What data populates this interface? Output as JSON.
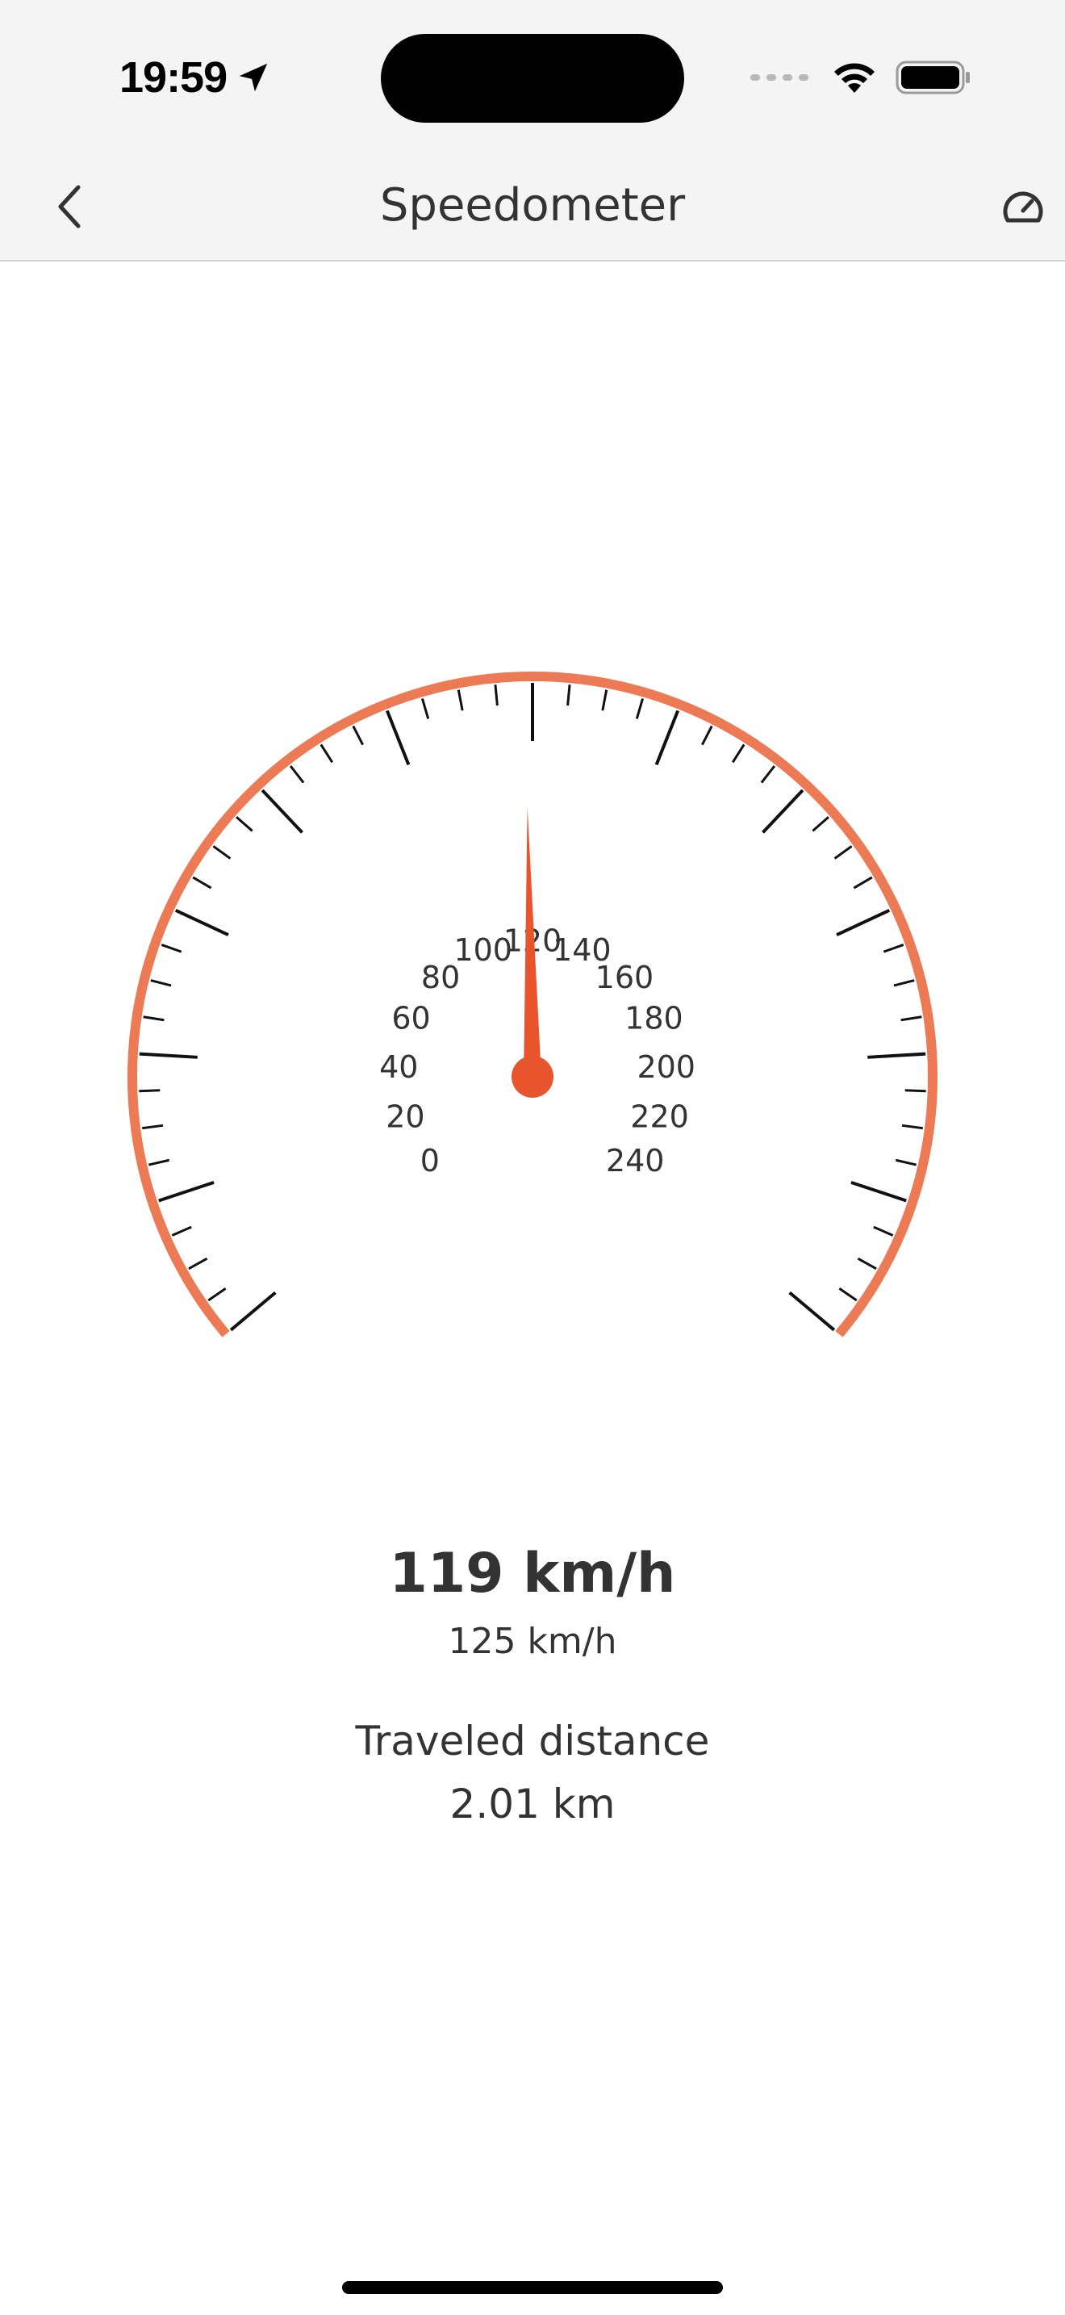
{
  "status_bar": {
    "time": "19:59",
    "icons": [
      "location-arrow-icon",
      "cellular-signal-icon",
      "wifi-icon",
      "battery-icon"
    ]
  },
  "nav": {
    "title": "Speedometer",
    "back_icon": "chevron-left-icon",
    "right_icon": "gauge-icon"
  },
  "gauge": {
    "min": 0,
    "max": 240,
    "labels": [
      "0",
      "20",
      "40",
      "60",
      "80",
      "100",
      "120",
      "140",
      "160",
      "180",
      "200",
      "220",
      "240"
    ],
    "needle_value": 119,
    "colors": {
      "arc": "#ec7a55",
      "needle": "#e8552d",
      "ticks": "#111111",
      "labels": "#333333"
    }
  },
  "readout": {
    "current_speed": "119 km/h",
    "secondary_speed": "125 km/h",
    "distance_label": "Traveled distance",
    "distance_value": "2.01 km"
  }
}
